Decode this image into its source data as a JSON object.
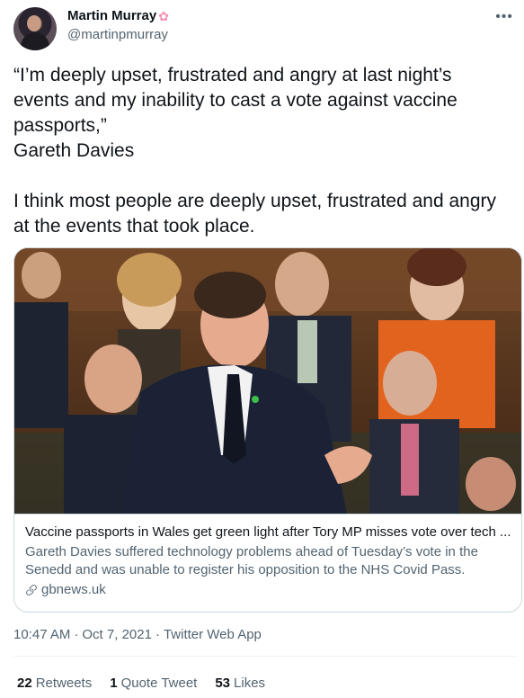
{
  "author": {
    "display_name": "Martin Murray",
    "handle": "@martinpmurray",
    "avatar_icon": "user-avatar",
    "badge_icon": "cherry-blossom-icon"
  },
  "more_icon": "more-options-icon",
  "tweet": {
    "text": "“I’m deeply upset, frustrated and angry at last night’s events and my inability to cast a vote against vaccine passports,”\nGareth Davies\n\nI think most people are deeply upset, frustrated and angry at the events that took place."
  },
  "card": {
    "title": "Vaccine passports in Wales get green light after Tory MP misses vote over tech ...",
    "description": "Gareth Davies suffered technology problems ahead of Tuesday’s vote in the Senedd and was unable to register his opposition to the NHS Covid Pass.",
    "domain": "gbnews.uk",
    "domain_icon": "link-icon"
  },
  "meta": {
    "time": "10:47 AM",
    "separator": "·",
    "date": "Oct 7, 2021",
    "source": "Twitter Web App"
  },
  "stats": {
    "retweets_count": "22",
    "retweets_label": "Retweets",
    "quotes_count": "1",
    "quotes_label": "Quote Tweet",
    "likes_count": "53",
    "likes_label": "Likes"
  },
  "colors": {
    "text_primary": "#0f1419",
    "text_secondary": "#536471",
    "border": "#cfd9de"
  }
}
